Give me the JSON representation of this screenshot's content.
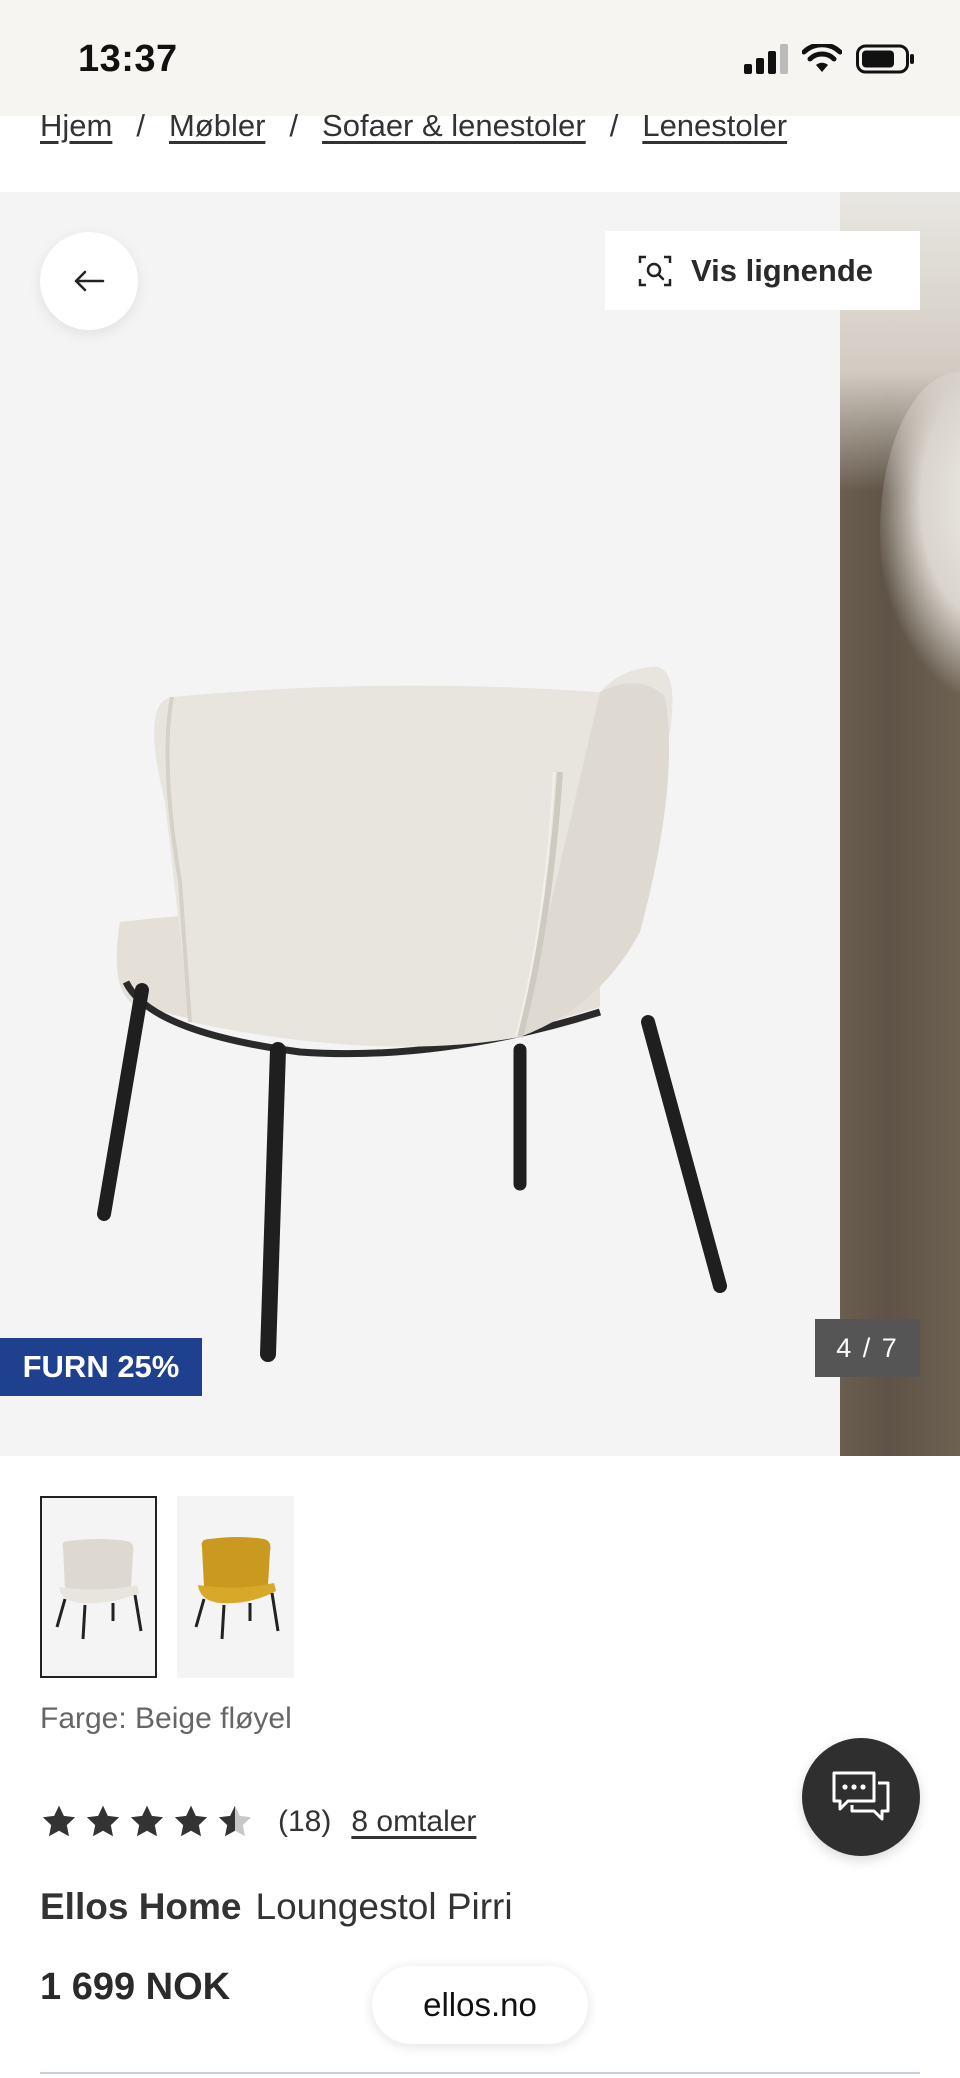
{
  "status_bar": {
    "time": "13:37"
  },
  "breadcrumb": [
    {
      "label": "Hjem"
    },
    {
      "label": "Møbler"
    },
    {
      "label": "Sofaer & lenestoler"
    },
    {
      "label": "Lenestoler"
    }
  ],
  "breadcrumb_separator": "/",
  "gallery": {
    "similar_label": "Vis lignende",
    "promo_badge": "FURN 25%",
    "counter": "4 / 7"
  },
  "thumbnails": [
    {
      "color": "beige",
      "selected": true
    },
    {
      "color": "mustard",
      "selected": false
    }
  ],
  "color_label": "Farge: Beige fløyel",
  "rating": {
    "stars": 4.5,
    "count_text": "(18)",
    "reviews_link": "8 omtaler"
  },
  "product": {
    "brand": "Ellos Home",
    "name": "Loungestol Pirri",
    "price": "1 699 NOK"
  },
  "browser": {
    "domain": "ellos.no"
  },
  "colors": {
    "promo_bg": "#1f3f8f",
    "counter_bg": "#555555",
    "chat_bg": "#2f2f2f",
    "accent_line": "#c9cde8"
  },
  "icons": {
    "back": "arrow-left-icon",
    "similar": "visual-search-icon",
    "chat": "chat-bubbles-icon",
    "star": "star-icon"
  }
}
